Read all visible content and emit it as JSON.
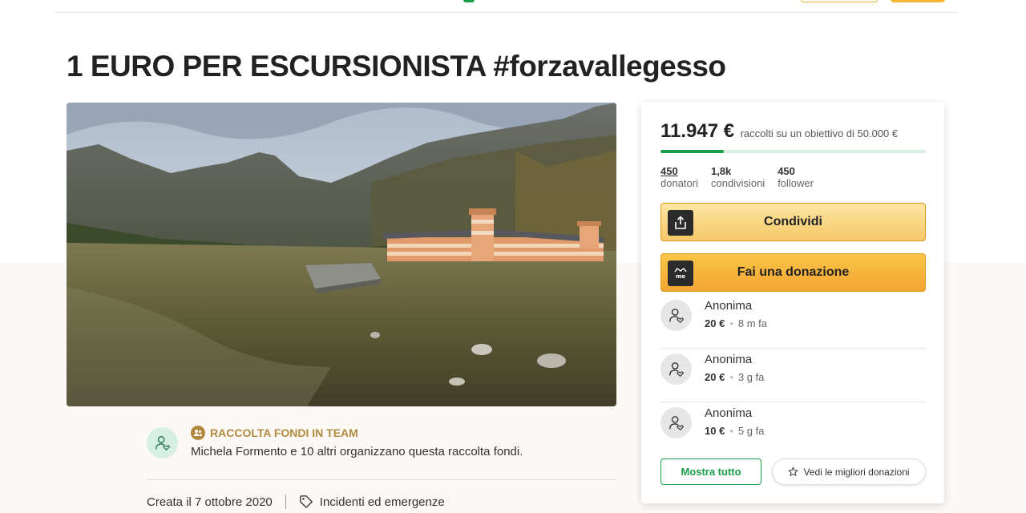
{
  "campaign": {
    "title": "1 EURO PER ESCURSIONISTA #forzavallegesso",
    "hero_image_alt": "Mountain valley with historic building"
  },
  "organizer": {
    "team_label": "RACCOLTA FONDI IN TEAM",
    "text": "Michela Formento e 10 altri organizzano questa raccolta fondi.",
    "created": "Creata il 7 ottobre 2020",
    "category": "Incidenti ed emergenze"
  },
  "card": {
    "raised_amount": "11.947 €",
    "raised_goal_text": "raccolti su un obiettivo di 50.000 €",
    "progress_fraction": 0.239,
    "stats": {
      "donors_count": "450",
      "donors_label": "donatori",
      "shares_count": "1,8k",
      "shares_label": "condivisioni",
      "followers_count": "450",
      "followers_label": "follower"
    },
    "share_label": "Condividi",
    "donate_label": "Fai una donazione",
    "donations": [
      {
        "name": "Anonima",
        "amount": "20 €",
        "time": "8 m fa"
      },
      {
        "name": "Anonima",
        "amount": "20 €",
        "time": "3 g fa"
      },
      {
        "name": "Anonima",
        "amount": "10 €",
        "time": "5 g fa"
      }
    ],
    "show_all_label": "Mostra tutto",
    "top_donations_label": "Vedi le migliori donazioni"
  },
  "colors": {
    "brand_green": "#1a9e4a",
    "accent_orange": "#f5b731",
    "team_gold": "#b18a3d"
  }
}
